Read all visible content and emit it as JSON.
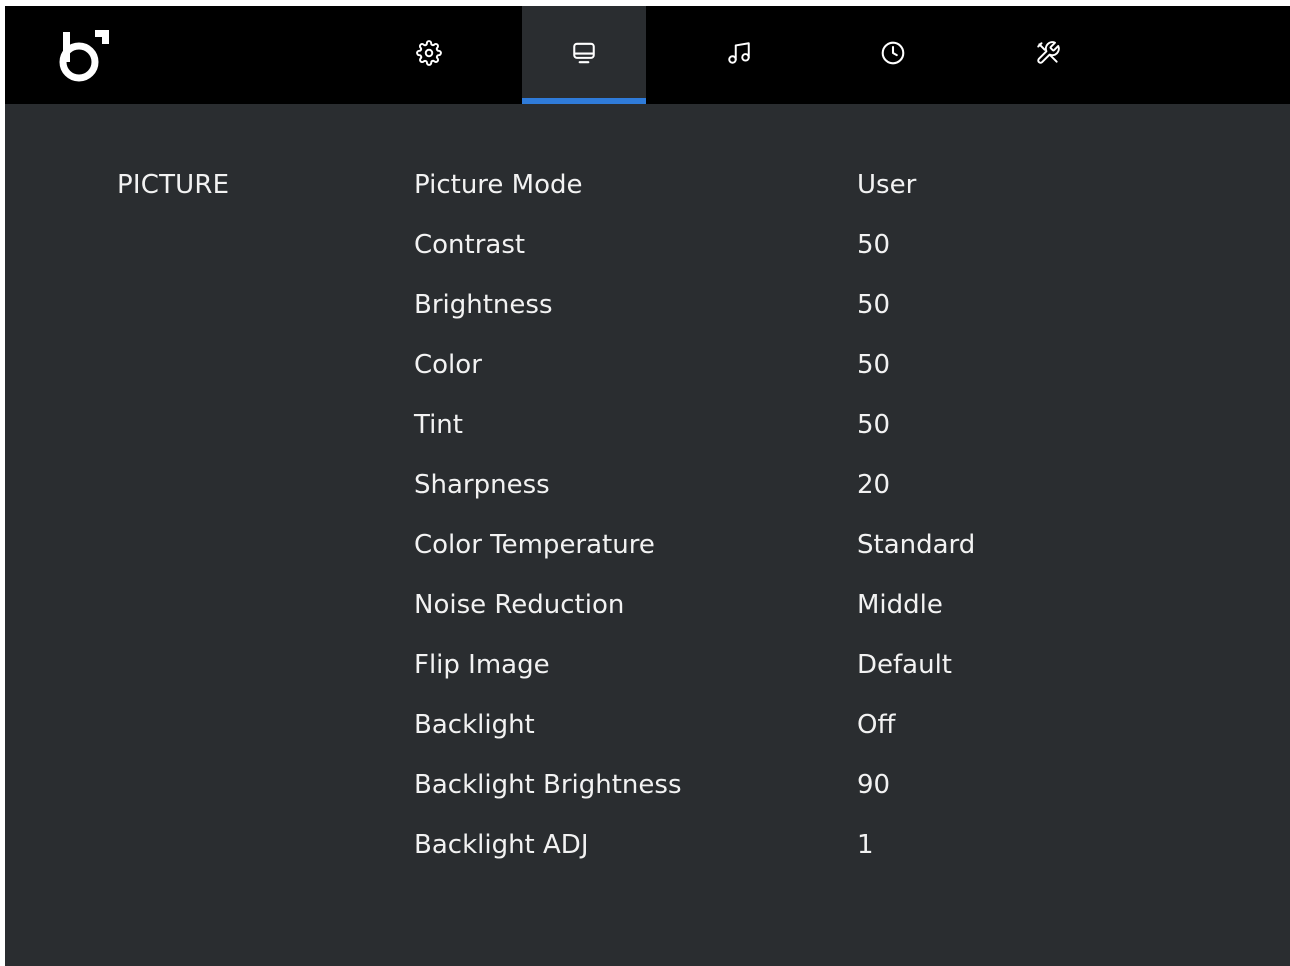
{
  "topbar": {
    "logo_icon": "b-logo-icon",
    "tabs": [
      {
        "icon": "gear-icon",
        "active": false
      },
      {
        "icon": "monitor-icon",
        "active": true
      },
      {
        "icon": "music-note-icon",
        "active": false
      },
      {
        "icon": "clock-icon",
        "active": false
      },
      {
        "icon": "tools-icon",
        "active": false
      }
    ],
    "active_color": "#2f7bd9"
  },
  "section": {
    "title": "PICTURE"
  },
  "settings": [
    {
      "label": "Picture Mode",
      "value": "User"
    },
    {
      "label": "Contrast",
      "value": "50"
    },
    {
      "label": "Brightness",
      "value": "50"
    },
    {
      "label": "Color",
      "value": "50"
    },
    {
      "label": "Tint",
      "value": "50"
    },
    {
      "label": "Sharpness",
      "value": "20"
    },
    {
      "label": "Color Temperature",
      "value": "Standard"
    },
    {
      "label": "Noise Reduction",
      "value": "Middle"
    },
    {
      "label": "Flip Image",
      "value": "Default"
    },
    {
      "label": "Backlight",
      "value": "Off"
    },
    {
      "label": "Backlight Brightness",
      "value": "90"
    },
    {
      "label": "Backlight ADJ",
      "value": "1"
    }
  ]
}
